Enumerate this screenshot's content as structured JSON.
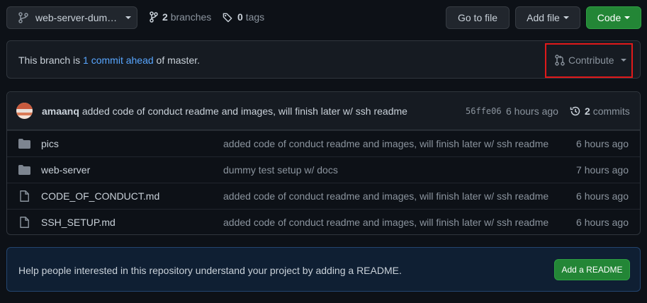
{
  "toolbar": {
    "branch_name": "web-server-dum…",
    "branches_count": "2",
    "branches_label": "branches",
    "tags_count": "0",
    "tags_label": "tags",
    "go_to_file": "Go to file",
    "add_file": "Add file",
    "code": "Code"
  },
  "branch_status": {
    "prefix": "This branch is",
    "link": "1 commit ahead",
    "suffix": "of master.",
    "contribute": "Contribute"
  },
  "latest_commit": {
    "author": "amaanq",
    "message": "added code of conduct readme and images, will finish later w/ ssh readme",
    "sha": "56ffe06",
    "time": "6 hours ago",
    "commits_count": "2",
    "commits_label": "commits"
  },
  "files": [
    {
      "type": "folder",
      "name": "pics",
      "message": "added code of conduct readme and images, will finish later w/ ssh readme",
      "age": "6 hours ago"
    },
    {
      "type": "folder",
      "name": "web-server",
      "message": "dummy test setup w/ docs",
      "age": "7 hours ago"
    },
    {
      "type": "file",
      "name": "CODE_OF_CONDUCT.md",
      "message": "added code of conduct readme and images, will finish later w/ ssh readme",
      "age": "6 hours ago"
    },
    {
      "type": "file",
      "name": "SSH_SETUP.md",
      "message": "added code of conduct readme and images, will finish later w/ ssh readme",
      "age": "6 hours ago"
    }
  ],
  "readme_prompt": {
    "text": "Help people interested in this repository understand your project by adding a README.",
    "button": "Add a README"
  },
  "colors": {
    "background": "#0d1117",
    "accent_link": "#58a6ff",
    "green_button": "#238636",
    "highlight_box": "#e0191a"
  }
}
